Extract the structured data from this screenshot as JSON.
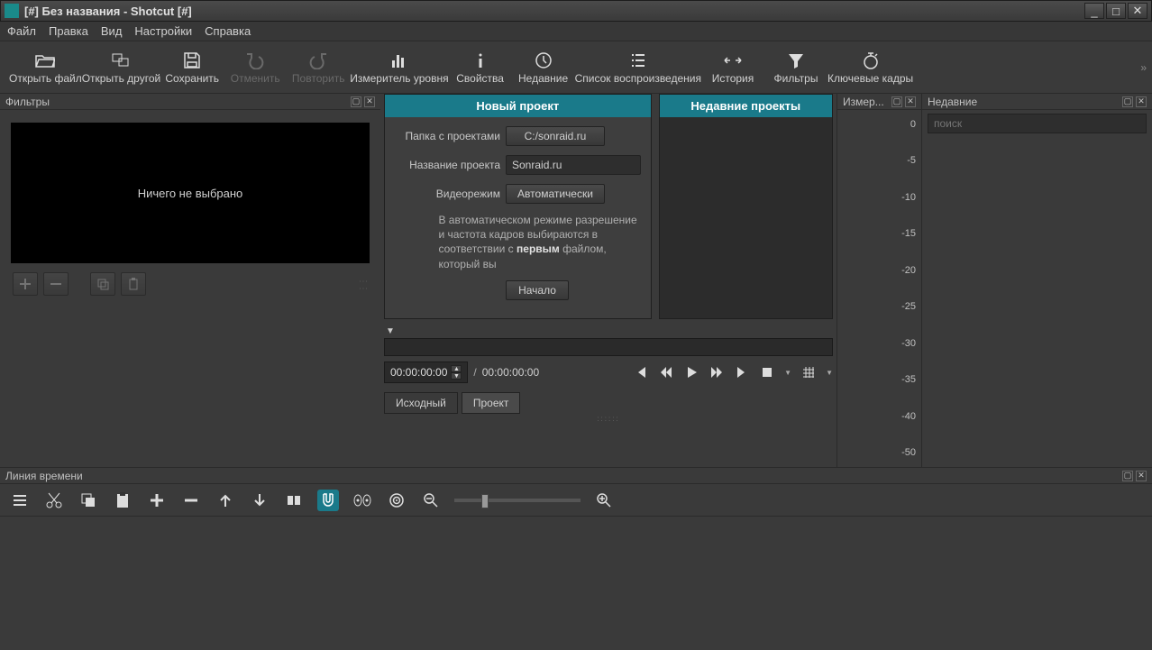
{
  "window": {
    "title": "[#] Без названия - Shotcut [#]"
  },
  "menu": {
    "file": "Файл",
    "edit": "Правка",
    "view": "Вид",
    "settings": "Настройки",
    "help": "Справка"
  },
  "toolbar": {
    "open_file": "Открыть файл",
    "open_other": "Открыть другой",
    "save": "Сохранить",
    "undo": "Отменить",
    "redo": "Повторить",
    "peak_meter": "Измеритель уровня",
    "properties": "Свойства",
    "recent": "Недавние",
    "playlist": "Список воспроизведения",
    "history": "История",
    "filters": "Фильтры",
    "keyframes": "Ключевые кадры"
  },
  "panels": {
    "filters_title": "Фильтры",
    "meter_title": "Измер...",
    "recent_title": "Недавние",
    "timeline_title": "Линия времени"
  },
  "filters_panel": {
    "nothing_selected": "Ничего не выбрано"
  },
  "project": {
    "new_project_title": "Новый проект",
    "recent_projects_title": "Недавние проекты",
    "folder_label": "Папка с проектами",
    "folder_value": "C:/sonraid.ru",
    "name_label": "Название проекта",
    "name_value": "Sonraid.ru",
    "mode_label": "Видеорежим",
    "mode_value": "Автоматически",
    "help_pre": "В автоматическом режиме разрешение и частота кадров выбираются в соответствии с ",
    "help_bold": "первым",
    "help_post": " файлом, который вы",
    "start_btn": "Начало"
  },
  "player": {
    "tc_in": "00:00:00:00",
    "tc_total": "00:00:00:00",
    "tab_source": "Исходный",
    "tab_project": "Проект"
  },
  "meter": {
    "ticks": [
      "0",
      "-5",
      "-10",
      "-15",
      "-20",
      "-25",
      "-30",
      "-35",
      "-40",
      "-50"
    ]
  },
  "recent_panel": {
    "search_placeholder": "поиск"
  }
}
